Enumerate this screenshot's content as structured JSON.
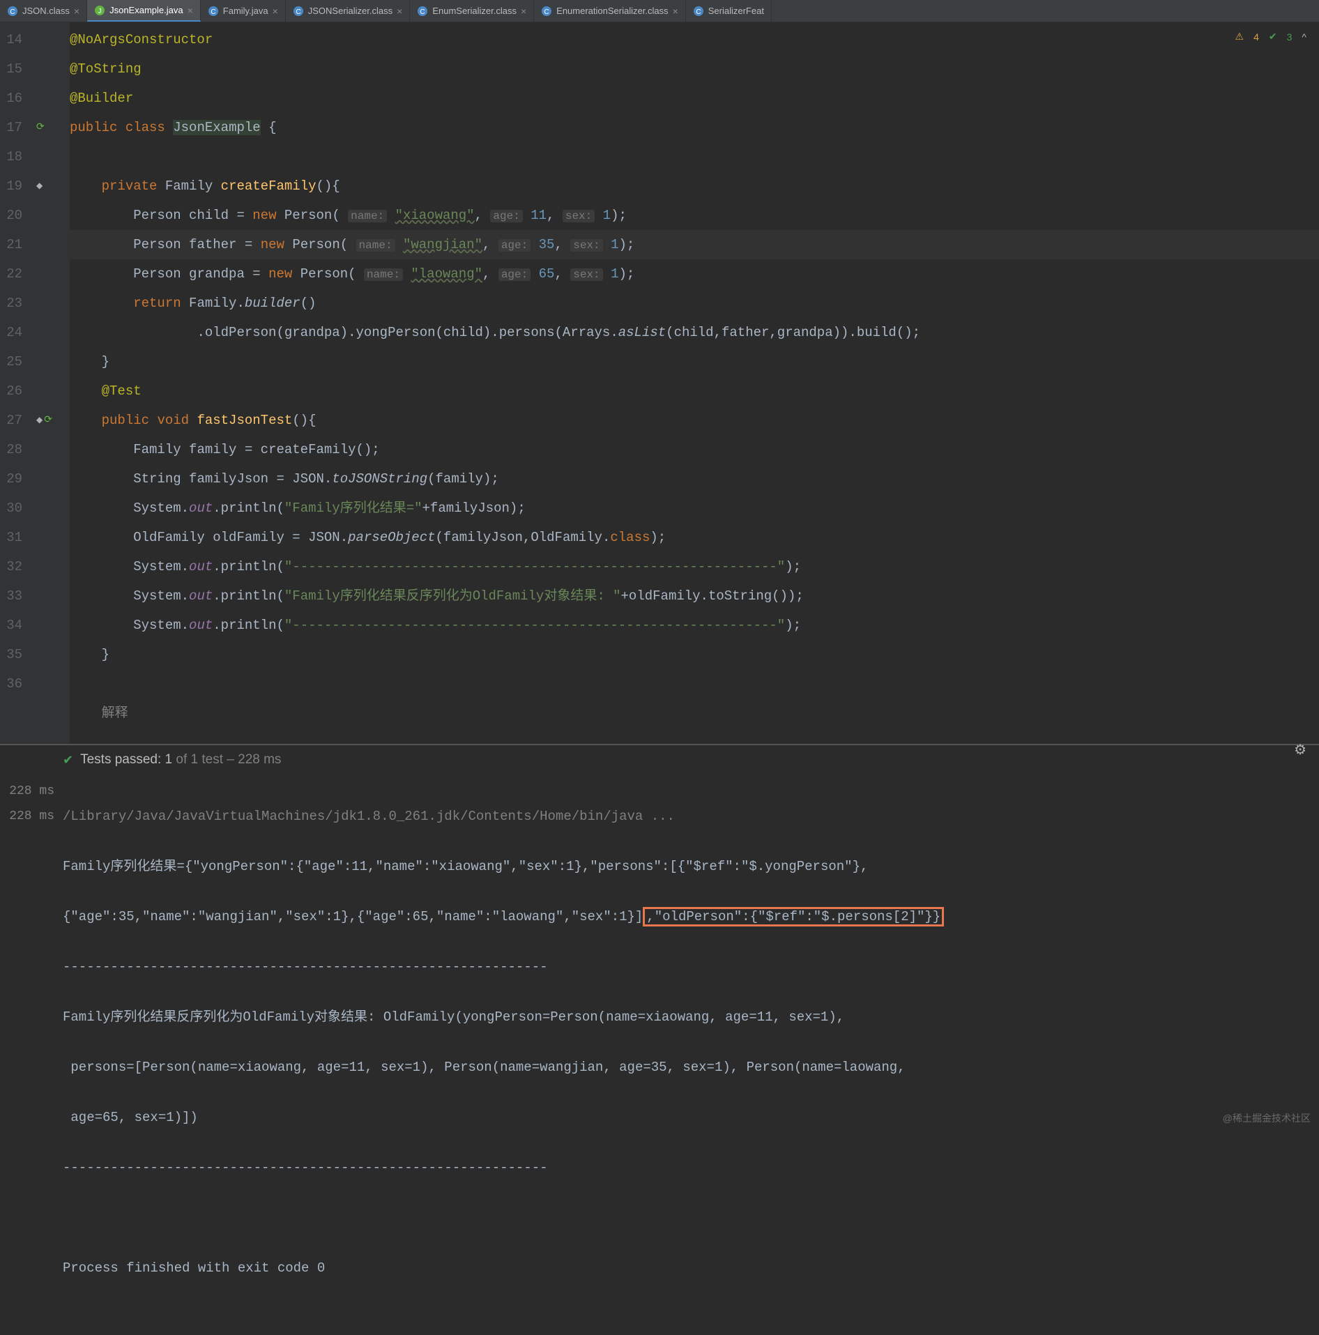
{
  "tabs": [
    {
      "label": "JSON.class",
      "icon": "class"
    },
    {
      "label": "JsonExample.java",
      "icon": "java",
      "active": true
    },
    {
      "label": "Family.java",
      "icon": "class"
    },
    {
      "label": "JSONSerializer.class",
      "icon": "class"
    },
    {
      "label": "EnumSerializer.class",
      "icon": "class"
    },
    {
      "label": "EnumerationSerializer.class",
      "icon": "class"
    },
    {
      "label": "SerializerFeat",
      "icon": "class",
      "noclose": true
    }
  ],
  "inspections": {
    "warnings": "4",
    "checks": "3",
    "chevron": "^"
  },
  "gutter_lines": [
    "14",
    "15",
    "16",
    "17",
    "18",
    "19",
    "20",
    "21",
    "22",
    "23",
    "24",
    "25",
    "26",
    "27",
    "28",
    "29",
    "30",
    "31",
    "32",
    "33",
    "34",
    "35",
    "36",
    ""
  ],
  "code": {
    "ann1": "@NoArgsConstructor",
    "ann2": "@ToString",
    "ann3": "@Builder",
    "kw_public": "public",
    "kw_class": "class",
    "cls_name": "JsonExample",
    "brace_open": " {",
    "kw_private": "private",
    "t_family": "Family",
    "m_createFamily": "createFamily",
    "m_paren": "(){",
    "t_person": "Person",
    "v_child": "child",
    "eq": " = ",
    "kw_new": "new",
    "h_name": "name:",
    "h_age": "age:",
    "h_sex": "sex:",
    "s_xiaowang": "\"xiaowang\"",
    "n_11": "11",
    "n_1": "1",
    "v_father": "father",
    "s_wangjian": "\"wangjian\"",
    "n_35": "35",
    "v_grandpa": "grandpa",
    "s_laowang": "\"laowang\"",
    "n_65": "65",
    "kw_return": "return",
    "m_builder": "builder",
    "chain": ".oldPerson(grandpa).yongPerson(child).persons(Arrays.",
    "m_asList": "asList",
    "chain2": "(child,father,grandpa)).build();",
    "brace_close": "}",
    "ann_test": "@Test",
    "kw_void": "void",
    "m_fastJsonTest": "fastJsonTest",
    "v_family": "family",
    "call_cf": " = createFamily();",
    "t_string": "String",
    "v_familyJson": "familyJson",
    "eq_json": " = JSON.",
    "m_toJSON": "toJSONString",
    "arg_family": "(family);",
    "sys": "System.",
    "f_out": "out",
    "m_println": ".println(",
    "s_res1": "\"Family序列化结果=\"",
    "plus_fj": "+familyJson);",
    "t_oldfamily": "OldFamily",
    "v_oldFamily": "oldFamily",
    "m_parseObject": "parseObject",
    "arg_parse": "(familyJson,OldFamily.",
    "kw_class2": "class",
    "end_parse": ");",
    "s_dashes": "\"-------------------------------------------------------------\"",
    "end_p": ");",
    "s_res2": "\"Family序列化结果反序列化为OldFamily对象结果: \"",
    "plus_old": "+oldFamily.toString());",
    "comment_ex": "解释"
  },
  "console": {
    "tests_passed_label": "Tests passed:",
    "tests_count": "1",
    "tests_total": "of 1 test – 228 ms",
    "time1": "228 ms",
    "time2": "228 ms",
    "java_path": "/Library/Java/JavaVirtualMachines/jdk1.8.0_261.jdk/Contents/Home/bin/java ...",
    "out_line1a": "Family序列化结果={\"yongPerson\":{\"age\":11,\"name\":\"xiaowang\",\"sex\":1},\"persons\":[{\"$ref\":\"$.yongPerson\"},",
    "out_line1b": "{\"age\":35,\"name\":\"wangjian\",\"sex\":1},{\"age\":65,\"name\":\"laowang\",\"sex\":1}]",
    "out_line1c": ",\"oldPerson\":{\"$ref\":\"$.persons[2]\"}}",
    "dashes": "-------------------------------------------------------------",
    "out_line2": "Family序列化结果反序列化为OldFamily对象结果: OldFamily(yongPerson=Person(name=xiaowang, age=11, sex=1),",
    "out_line2b": " persons=[Person(name=xiaowang, age=11, sex=1), Person(name=wangjian, age=35, sex=1), Person(name=laowang,",
    "out_line2c": " age=65, sex=1)])",
    "exit": "Process finished with exit code 0"
  },
  "watermark": "@稀土掘金技术社区"
}
